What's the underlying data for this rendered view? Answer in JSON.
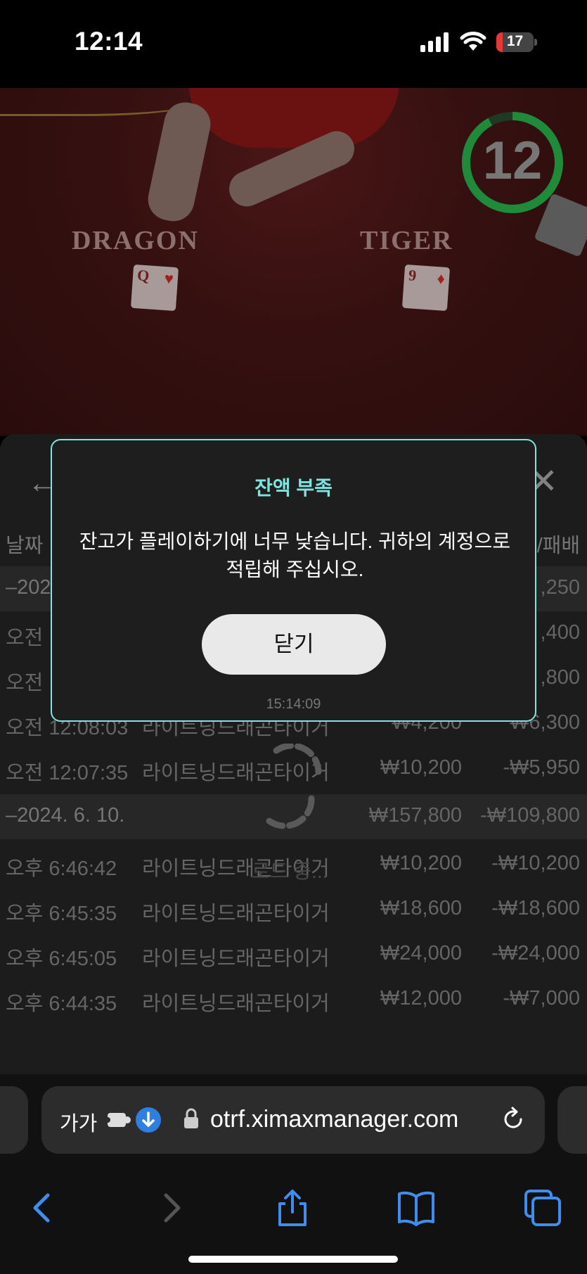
{
  "status_bar": {
    "time": "12:14",
    "battery_level": 17,
    "battery_text": "17",
    "battery_color": "#e53935"
  },
  "game": {
    "dragon_label": "DRAGON",
    "tiger_label": "TIGER",
    "timer": "12",
    "dragon_card": {
      "rank": "Q",
      "suit": "♥"
    },
    "tiger_card": {
      "rank": "9",
      "suit": "♦"
    },
    "timer_color": "#1f8a3a"
  },
  "history": {
    "header_date": "날짜",
    "header_winloss": "/패배",
    "rows": [
      {
        "type": "group",
        "time": "–202",
        "game": "",
        "bet": "",
        "result": ",250"
      },
      {
        "type": "item",
        "time": "오전",
        "game": "",
        "bet": "",
        "result": ",400"
      },
      {
        "type": "item",
        "time": "오전",
        "game": "",
        "bet": "",
        "result": ",800"
      },
      {
        "type": "item",
        "time": "오전 12:08:03",
        "game": "라이트닝드래곤타이거",
        "bet": "₩4,200",
        "result": "₩6,300"
      },
      {
        "type": "item",
        "time": "오전 12:07:35",
        "game": "라이트닝드래곤타이거",
        "bet": "₩10,200",
        "result": "-₩5,950"
      },
      {
        "type": "group",
        "time": "–2024. 6. 10.",
        "game": "",
        "bet": "₩157,800",
        "result": "-₩109,800"
      },
      {
        "type": "item",
        "time": "오후 6:46:42",
        "game": "라이트닝드래곤타이거",
        "bet": "₩10,200",
        "result": "-₩10,200"
      },
      {
        "type": "item",
        "time": "오후 6:45:35",
        "game": "라이트닝드래곤타이거",
        "bet": "₩18,600",
        "result": "-₩18,600"
      },
      {
        "type": "item",
        "time": "오후 6:45:05",
        "game": "라이트닝드래곤타이거",
        "bet": "₩24,000",
        "result": "-₩24,000"
      },
      {
        "type": "item",
        "time": "오후 6:44:35",
        "game": "라이트닝드래곤타이거",
        "bet": "₩12,000",
        "result": "-₩7,000"
      }
    ],
    "loading_text": "로드 중..."
  },
  "modal": {
    "title": "잔액 부족",
    "message": "잔고가 플레이하기에 너무 낮습니다. 귀하의 계정으로 적립해 주십시오.",
    "button_label": "닫기",
    "timestamp": "15:14:09",
    "accent_color": "#7fe3e0"
  },
  "browser": {
    "text_size_label": "가가",
    "url": "otrf.ximaxmanager.com",
    "accent_color": "#2f7fe0"
  }
}
